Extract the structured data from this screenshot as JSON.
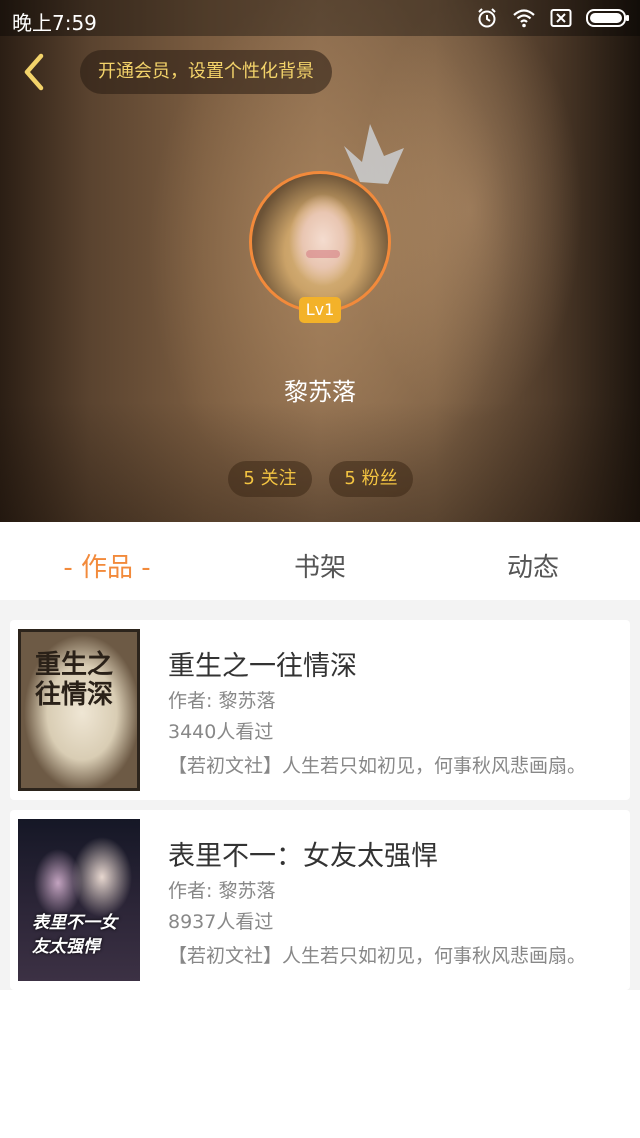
{
  "status_bar": {
    "time": "晚上7:59",
    "icons": [
      "alarm-icon",
      "wifi-icon",
      "sim-icon",
      "battery-icon"
    ]
  },
  "header": {
    "back_icon": "chevron-left-icon",
    "vip_banner": "开通会员，设置个性化背景",
    "crown_icon": "crown-icon",
    "level": "Lv1",
    "username": "黎苏落",
    "follow": "5 关注",
    "fans": "5 粉丝"
  },
  "tabs": [
    {
      "label": "- 作品 -",
      "active": true
    },
    {
      "label": "书架",
      "active": false
    },
    {
      "label": "动态",
      "active": false
    }
  ],
  "books": [
    {
      "title": "重生之一往情深",
      "author": "作者: 黎苏落",
      "views": "3440人看过",
      "desc": "【若初文社】人生若只如初见，何事秋风悲画扇。",
      "cover_text": "重生之往情深"
    },
    {
      "title": "表里不一：女友太强悍",
      "author": "作者: 黎苏落",
      "views": "8937人看过",
      "desc": "【若初文社】人生若只如初见，何事秋风悲画扇。",
      "cover_text": "表里不一女友太强悍"
    }
  ],
  "colors": {
    "accent": "#f28a3b",
    "gold": "#f3c441",
    "level_badge": "#f3b229",
    "text_primary": "#333333",
    "text_secondary": "#888888"
  }
}
